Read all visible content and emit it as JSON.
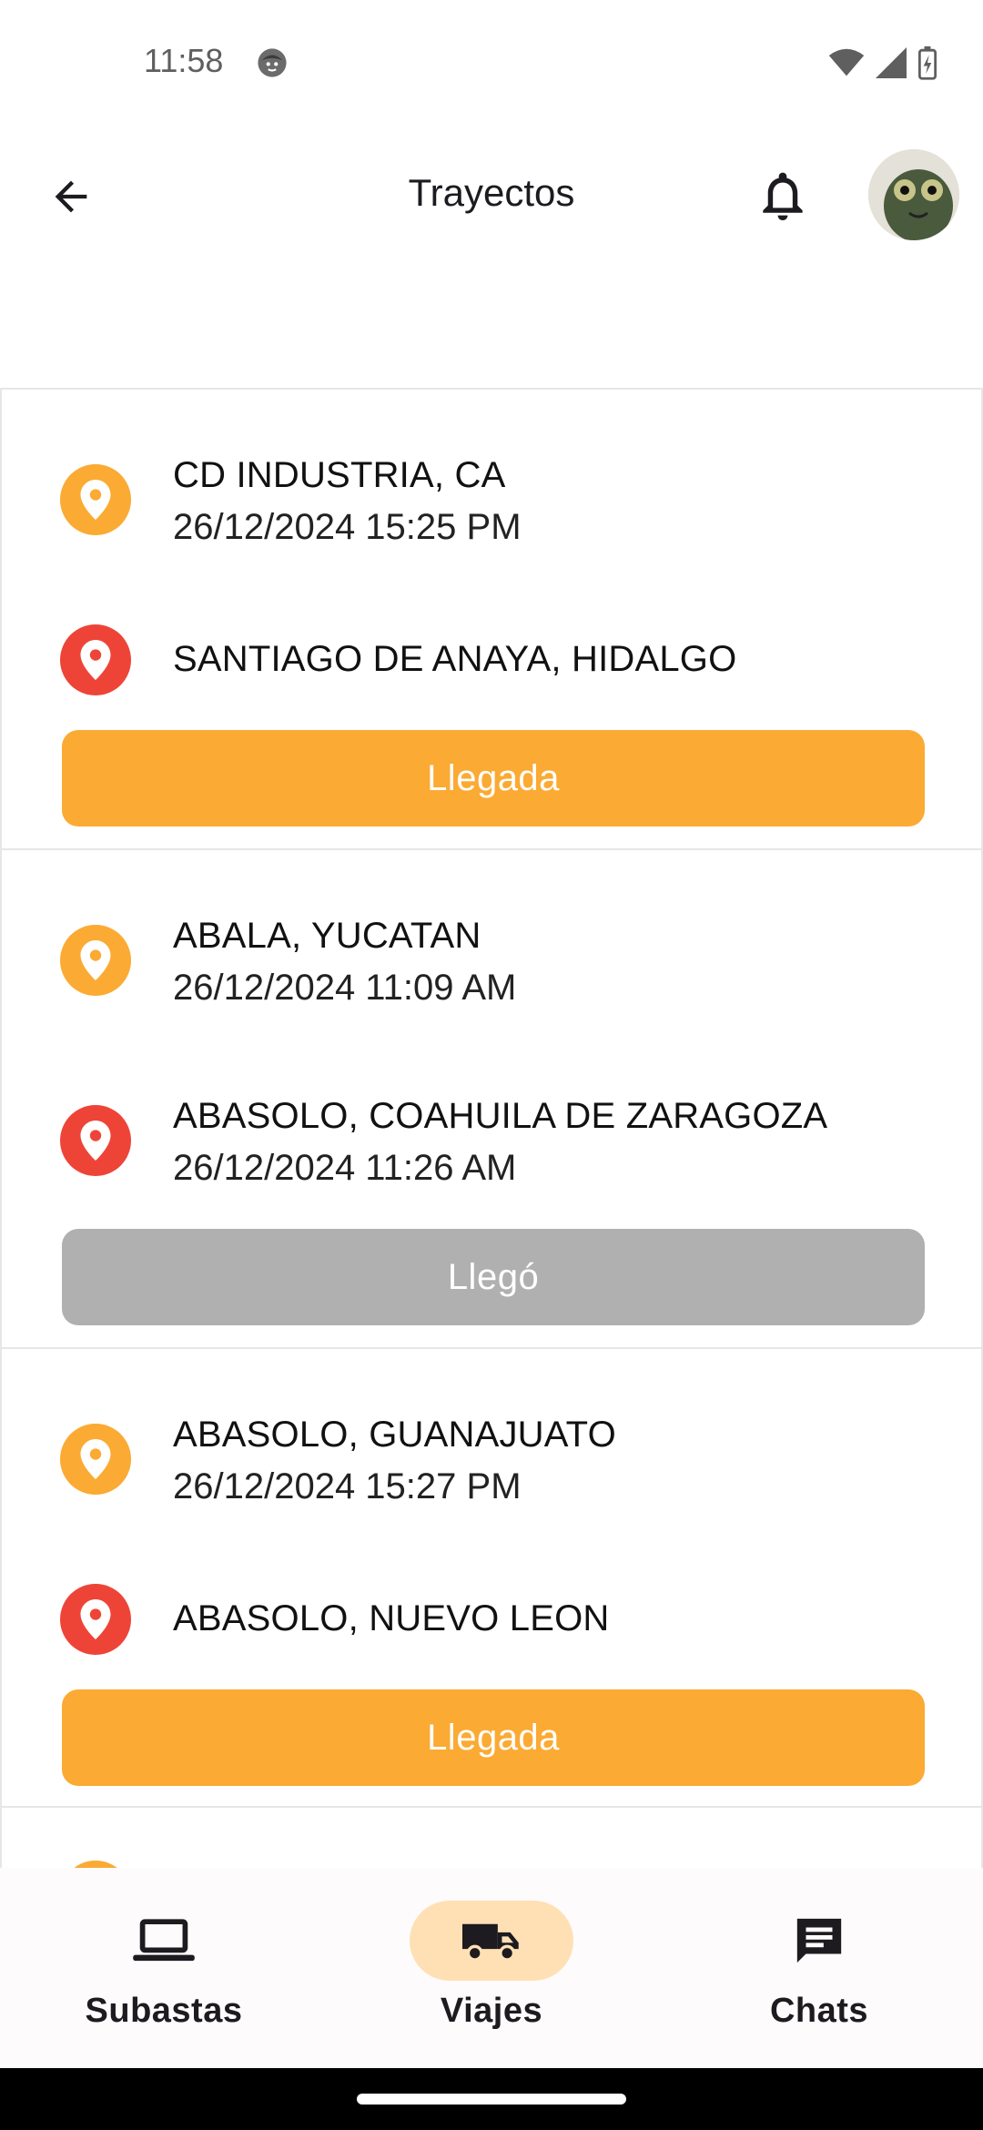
{
  "status": {
    "time": "11:58"
  },
  "appbar": {
    "title": "Trayectos"
  },
  "trips": [
    {
      "origin": {
        "place": "CD INDUSTRIA, CA",
        "date": "26/12/2024 15:25 PM"
      },
      "destination": {
        "place": "SANTIAGO DE ANAYA, HIDALGO",
        "date": ""
      },
      "action": "Llegada",
      "state": "active"
    },
    {
      "origin": {
        "place": "ABALA, YUCATAN",
        "date": "26/12/2024 11:09 AM"
      },
      "destination": {
        "place": "ABASOLO, COAHUILA DE ZARAGOZA",
        "date": "26/12/2024 11:26 AM"
      },
      "action": "Llegó",
      "state": "done"
    },
    {
      "origin": {
        "place": "ABASOLO, GUANAJUATO",
        "date": "26/12/2024 15:27 PM"
      },
      "destination": {
        "place": "ABASOLO, NUEVO LEON",
        "date": ""
      },
      "action": "Llegada",
      "state": "active"
    }
  ],
  "nav": {
    "items": [
      {
        "label": "Subastas",
        "icon": "laptop-icon"
      },
      {
        "label": "Viajes",
        "icon": "truck-icon",
        "selected": true
      },
      {
        "label": "Chats",
        "icon": "chat-icon"
      }
    ]
  },
  "colors": {
    "accent": "#fbaa33",
    "origin_pin": "#fbaa33",
    "destination_pin": "#ee4438",
    "done_button": "#b0b0b0",
    "nav_selected": "#ffe0b5"
  }
}
